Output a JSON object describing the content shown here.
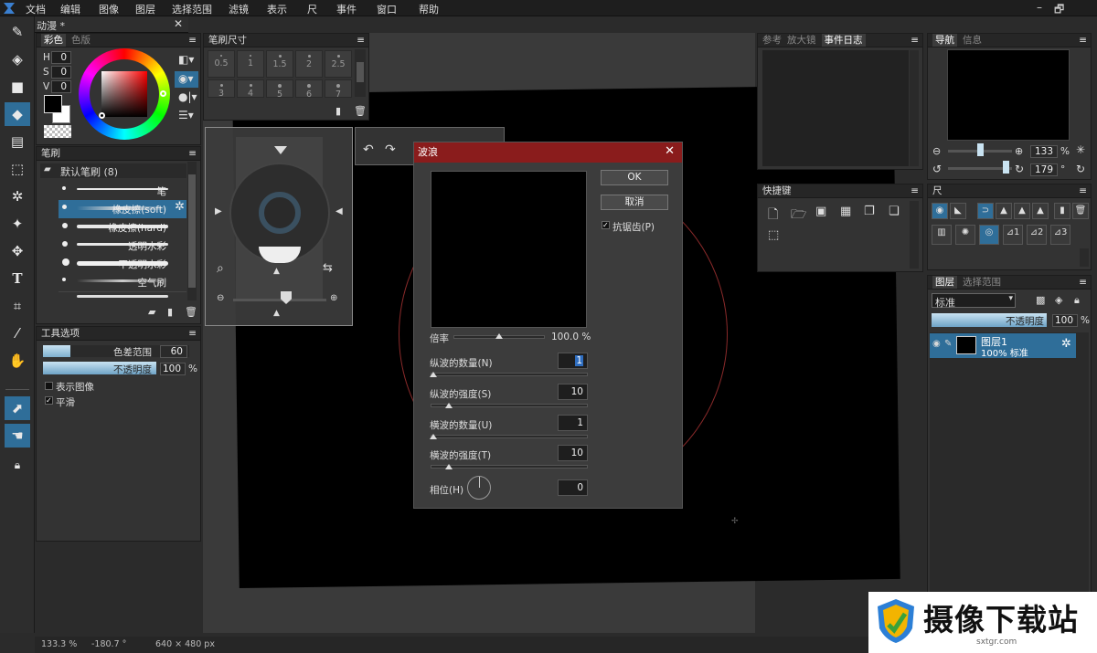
{
  "menu": [
    "文档",
    "编辑",
    "图像",
    "图层",
    "选择范围",
    "滤镜",
    "表示",
    "尺",
    "事件",
    "窗口",
    "帮助"
  ],
  "window_controls": {
    "minimize": "–",
    "restore": "🗗"
  },
  "doc_tab": {
    "title": "动漫 *",
    "close": "✕"
  },
  "color_panel": {
    "tabs": [
      "彩色",
      "色版"
    ],
    "h_label": "H",
    "h": "0",
    "s_label": "S",
    "s": "0",
    "v_label": "V",
    "v": "0"
  },
  "brush_size_panel": {
    "title": "笔刷尺寸",
    "row1": [
      "0.5",
      "1",
      "1.5",
      "2",
      "2.5"
    ],
    "row2": [
      "3",
      "4",
      "5",
      "6",
      "7"
    ]
  },
  "brush_panel": {
    "title": "笔刷",
    "group": "默认笔刷 (8)",
    "items": [
      {
        "name": "笔"
      },
      {
        "name": "橡皮擦(soft)"
      },
      {
        "name": "橡皮擦(hard)"
      },
      {
        "name": "透明水彩"
      },
      {
        "name": "不透明水彩"
      },
      {
        "name": "空气刷"
      }
    ]
  },
  "tool_options": {
    "title": "工具选项",
    "tolerance_label": "色差范围",
    "tolerance": "60",
    "opacity_label": "不透明度",
    "opacity": "100",
    "opacity_unit": "%",
    "show_image": "表示图像",
    "smooth": "平滑"
  },
  "dialog": {
    "title": "波浪",
    "close": "✕",
    "ok": "OK",
    "cancel": "取消",
    "antialias": "抗锯齿(P)",
    "scale_label": "倍率",
    "scale": "100.0 %",
    "v_count_label": "纵波的数量(N)",
    "v_count": "1",
    "v_strength_label": "纵波的强度(S)",
    "v_strength": "10",
    "h_count_label": "横波的数量(U)",
    "h_count": "1",
    "h_strength_label": "横波的强度(T)",
    "h_strength": "10",
    "phase_label": "相位(H)",
    "phase": "0"
  },
  "right_top_panel": {
    "tabs": [
      "参考",
      "放大镜",
      "事件日志"
    ]
  },
  "shortcuts_panel": {
    "title": "快捷键"
  },
  "navigator": {
    "tabs": [
      "导航",
      "信息"
    ],
    "zoom": "133",
    "zoom_unit": "%",
    "rotation": "179",
    "rotation_unit": "°"
  },
  "ruler_panel": {
    "title": "尺"
  },
  "layers": {
    "tabs": [
      "图层",
      "选择范围"
    ],
    "blend": "标准",
    "opacity_label": "不透明度",
    "opacity": "100",
    "opacity_unit": "%",
    "layer_name": "图层1",
    "layer_info": "100% 标准"
  },
  "status": {
    "zoom": "133.3 %",
    "angle": "-180.7 °",
    "size": "640 × 480 px"
  },
  "watermark": {
    "text": "摄像下载站",
    "url": "sxtgr.com"
  }
}
